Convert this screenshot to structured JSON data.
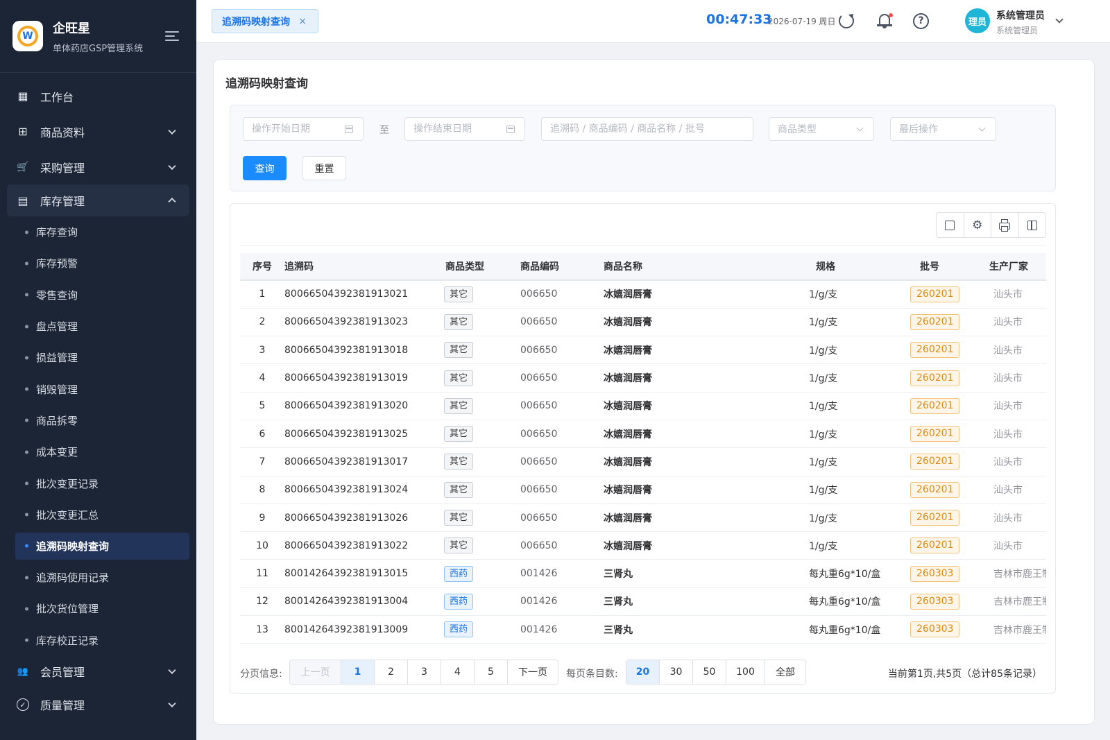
{
  "brand": {
    "title": "企旺星",
    "subtitle": "单体药店GSP管理系统",
    "logo_letter": "W"
  },
  "sidebar": {
    "menu": [
      {
        "label": "工作台",
        "icon": "dashboard-icon",
        "glyph": "▦"
      },
      {
        "label": "商品资料",
        "icon": "goods-icon",
        "glyph": "⊞"
      },
      {
        "label": "采购管理",
        "icon": "cart-icon",
        "glyph": "🛒"
      },
      {
        "label": "库存管理",
        "icon": "inventory-icon",
        "glyph": "▤"
      }
    ],
    "inventory_sub": [
      "库存查询",
      "库存预警",
      "零售查询",
      "盘点管理",
      "损益管理",
      "销毁管理",
      "商品拆零",
      "成本变更",
      "批次变更记录",
      "批次变更汇总",
      "追溯码映射查询",
      "追溯码使用记录",
      "批次货位管理",
      "库存校正记录"
    ],
    "bottom_menu": [
      {
        "label": "会员管理",
        "icon": "members-icon",
        "glyph": "👥"
      },
      {
        "label": "质量管理",
        "icon": "quality-icon",
        "glyph": "✓"
      }
    ]
  },
  "topbar": {
    "tab_label": "追溯码映射查询",
    "tab_close": "×",
    "clock": "00:47:33",
    "date": "2026-07-19 周日",
    "help": "?",
    "avatar_text": "理员",
    "user_name": "系统管理员",
    "user_role": "系统管理员"
  },
  "page": {
    "title": "追溯码映射查询"
  },
  "filters": {
    "start_date_placeholder": "操作开始日期",
    "to_label": "至",
    "end_date_placeholder": "操作结束日期",
    "search_placeholder": "追溯码 / 商品编码 / 商品名称 / 批号",
    "type_placeholder": "商品类型",
    "last_op_placeholder": "最后操作",
    "query_button": "查询",
    "reset_button": "重置"
  },
  "table": {
    "columns": [
      "序号",
      "追溯码",
      "商品类型",
      "商品编码",
      "商品名称",
      "规格",
      "批号",
      "生产厂家"
    ],
    "rows": [
      [
        "1",
        "80066504392381913021",
        "其它",
        "006650",
        "冰嬉润唇膏",
        "1/g/支",
        "260201",
        "汕头市"
      ],
      [
        "2",
        "80066504392381913023",
        "其它",
        "006650",
        "冰嬉润唇膏",
        "1/g/支",
        "260201",
        "汕头市"
      ],
      [
        "3",
        "80066504392381913018",
        "其它",
        "006650",
        "冰嬉润唇膏",
        "1/g/支",
        "260201",
        "汕头市"
      ],
      [
        "4",
        "80066504392381913019",
        "其它",
        "006650",
        "冰嬉润唇膏",
        "1/g/支",
        "260201",
        "汕头市"
      ],
      [
        "5",
        "80066504392381913020",
        "其它",
        "006650",
        "冰嬉润唇膏",
        "1/g/支",
        "260201",
        "汕头市"
      ],
      [
        "6",
        "80066504392381913025",
        "其它",
        "006650",
        "冰嬉润唇膏",
        "1/g/支",
        "260201",
        "汕头市"
      ],
      [
        "7",
        "80066504392381913017",
        "其它",
        "006650",
        "冰嬉润唇膏",
        "1/g/支",
        "260201",
        "汕头市"
      ],
      [
        "8",
        "80066504392381913024",
        "其它",
        "006650",
        "冰嬉润唇膏",
        "1/g/支",
        "260201",
        "汕头市"
      ],
      [
        "9",
        "80066504392381913026",
        "其它",
        "006650",
        "冰嬉润唇膏",
        "1/g/支",
        "260201",
        "汕头市"
      ],
      [
        "10",
        "80066504392381913022",
        "其它",
        "006650",
        "冰嬉润唇膏",
        "1/g/支",
        "260201",
        "汕头市"
      ],
      [
        "11",
        "80014264392381913015",
        "西药",
        "001426",
        "三肾丸",
        "每丸重6g*10/盒",
        "260303",
        "吉林市鹿王制"
      ],
      [
        "12",
        "80014264392381913004",
        "西药",
        "001426",
        "三肾丸",
        "每丸重6g*10/盒",
        "260303",
        "吉林市鹿王制"
      ],
      [
        "13",
        "80014264392381913009",
        "西药",
        "001426",
        "三肾丸",
        "每丸重6g*10/盒",
        "260303",
        "吉林市鹿王制"
      ]
    ]
  },
  "pager": {
    "label": "分页信息:",
    "prev": "上一页",
    "pages": [
      "1",
      "2",
      "3",
      "4",
      "5"
    ],
    "next": "下一页",
    "size_label": "每页条目数:",
    "sizes": [
      "20",
      "30",
      "50",
      "100",
      "全部"
    ],
    "info": "当前第1页,共5页（总计85条记录）"
  },
  "colors": {
    "primary": "#1a8cff",
    "sidebar_bg": "#1c2535",
    "batch_tag": "#e08a0c"
  }
}
